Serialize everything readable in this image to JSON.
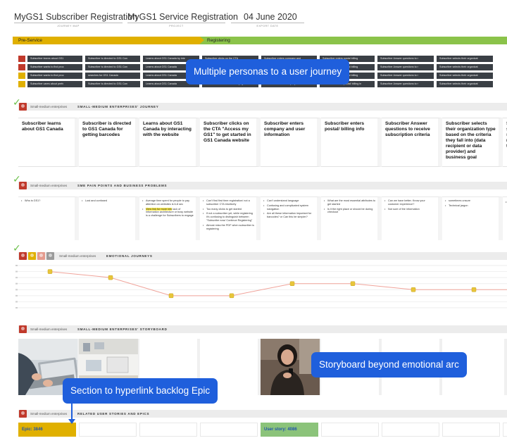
{
  "header": {
    "journey_map_title": "MyGS1 Subscriber Registration",
    "journey_map_caption": "JOURNEY MAP",
    "project_title": "MyGS1 Service Registration",
    "project_caption": "PROJECT",
    "date": "04 June 2020",
    "date_caption": "EXPORT DATE"
  },
  "phases": [
    {
      "label": "Pre-Service",
      "color": "#e0b000"
    },
    {
      "label": "Registering",
      "color": "#8bc34a"
    }
  ],
  "persona_grid": {
    "rows": [
      [
        "Subscriber learns about GS1",
        "Subscriber is directed to GS1 Can",
        "Learns about GS1 Canada by inte",
        "Subscriber clicks on the CTA",
        "Subscriber enters company and",
        "Subscriber enters postal billing",
        "Subscriber Answer questions to r",
        "Subscriber selects their organizat"
      ],
      [
        "Subscriber wants to find proc",
        "Subscriber is directed to GS1 Can",
        "Learns about GS1 Canada",
        "Subscriber clicks on the CTA",
        "Subscriber enters company and",
        "Subscriber enters postal billing",
        "Subscriber Answer questions to r",
        "Subscriber selects their organizat"
      ],
      [
        "Subscriber wants to find proc",
        "searches for GS1 Canada",
        "Learns about GS1 Canada",
        "Subscriber clicks on the CTA",
        "Subscriber enters company and",
        "Subscriber enters postal billing",
        "Subscriber Answer questions to r",
        "Subscriber selects their organizat"
      ],
      [
        "Subscriber cares about prefx",
        "Subscriber is directed to GS1 Can",
        "Learns about GS1 Canada",
        "Subscriber clicks on the CTA (e.g.",
        "Subscriber enters company and i",
        "Subscriber enters postal/ billing in",
        "Subscriber Answer questions to r",
        "Subscriber selects their organizat"
      ]
    ]
  },
  "journey_section": {
    "persona": "Small-medium enterprises",
    "title": "SMALL-MEDIUM ENTERPRISES' JOURNEY",
    "cards": [
      "Subscriber learns about GS1 Canada",
      "Subscriber is directed to GS1 Canada for getting barcodes",
      "Learns about GS1 Canada by interacting with the website",
      "Subscriber clicks on the CTA \"Access my GS1\" to get started in GS1 Canada website",
      "Subscriber enters company and user information",
      "Subscriber enters postal/ billing info",
      "Subscriber Answer questions to receive subscription criteria",
      "Subscriber selects their organization type based on the criteria they fall into (data recipient or data provider) and business goal",
      "S s s n t"
    ]
  },
  "pain_section": {
    "persona": "Small-medium enterprises",
    "title": "SME PAIN POINTS AND BUSINESS PROBLEMS",
    "columns": [
      [
        "Who is GS1?"
      ],
      [
        "Lost and confused"
      ],
      [
        "Average time spent for people to pay attention on websites is 6-8 sec",
        "View link for more info lack of information architecture or busy website is a challenge for Subscribers to engage"
      ],
      [
        "Can't find first time registration/ not a subscriber CTA intuitively",
        "Too many clicks to get started",
        "If not a subscriber yet, while registering it's confusing to distinguish between \"Subscribe now/ Continue Registering\"",
        "Almost miss the PDF when subscriber is registering"
      ],
      [
        "Can't understand language",
        "Confusing and complicated system navigation",
        "Are all these information important for barcodes? or Can this be simpler?"
      ],
      [
        "What are the most essential attributes to get started",
        "Is it the right place or should be during checkout"
      ],
      [
        "Can we have better. Know your customer experience?",
        "Not sure of the information"
      ],
      [
        "sometimes unsure",
        "Technical jargon"
      ],
      [
        "",
        ""
      ]
    ]
  },
  "emotion_section": {
    "persona": "Small-medium enterprises",
    "title": "EMOTIONAL JOURNEYS"
  },
  "chart_data": {
    "type": "line",
    "x": [
      1,
      2,
      3,
      4,
      5,
      6,
      7,
      8,
      9
    ],
    "series": [
      {
        "values": [
          6,
          5,
          2,
          2,
          4,
          4,
          3,
          3,
          3
        ]
      }
    ],
    "ylim": [
      0,
      7
    ],
    "grid": true,
    "line_color": "#f0a39a",
    "marker_color": "#e8c53a"
  },
  "storyboard_section": {
    "persona": "Small-medium enterprises",
    "title": "SMALL-MEDIUM ENTERPRISES' STORYBOARD"
  },
  "stories_section": {
    "persona": "Small-medium enterprises",
    "title": "RELATED USER STORIES AND EPICS",
    "items": [
      {
        "label": "Epic: 3846",
        "color": "#e0b000"
      },
      {
        "label": "",
        "color": ""
      },
      {
        "label": "",
        "color": ""
      },
      {
        "label": "",
        "color": ""
      },
      {
        "label": "User story: 4086",
        "color": "#8bc37a"
      },
      {
        "label": "",
        "color": ""
      },
      {
        "label": "",
        "color": ""
      },
      {
        "label": "",
        "color": ""
      },
      {
        "label": "",
        "color": ""
      }
    ]
  },
  "callouts": {
    "personas": "Multiple personas to a user journey",
    "storyboard": "Storyboard beyond emotional arc",
    "backlog": "Section to hyperlink backlog Epic"
  },
  "icons": {
    "check": "check-icon",
    "avatar": "persona-avatar-icon"
  }
}
